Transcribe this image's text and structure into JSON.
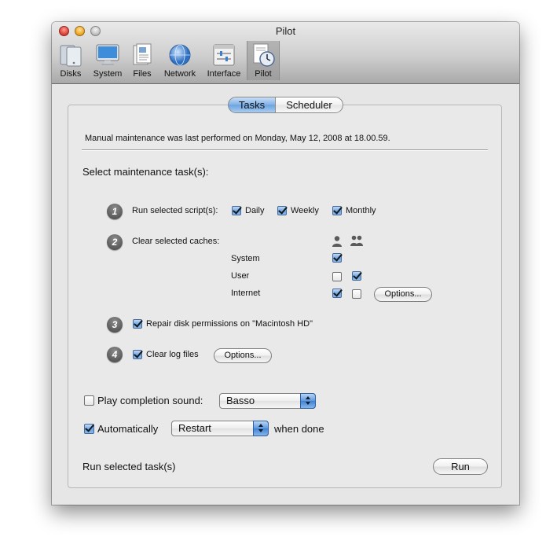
{
  "window": {
    "title": "Pilot"
  },
  "toolbar": {
    "items": [
      {
        "label": "Disks",
        "icon": "disks-icon"
      },
      {
        "label": "System",
        "icon": "monitor-icon"
      },
      {
        "label": "Files",
        "icon": "files-icon"
      },
      {
        "label": "Network",
        "icon": "globe-icon"
      },
      {
        "label": "Interface",
        "icon": "sliders-icon"
      },
      {
        "label": "Pilot",
        "icon": "pilot-clock-icon",
        "selected": true
      }
    ]
  },
  "tabs": {
    "tasks": "Tasks",
    "scheduler": "Scheduler",
    "selected": "Tasks"
  },
  "status": {
    "last_performed": "Manual maintenance was last performed on Monday, May 12, 2008 at 18.00.59."
  },
  "tasks": {
    "heading": "Select maintenance task(s):",
    "step1": {
      "number": "1",
      "label": "Run selected script(s):",
      "daily": {
        "label": "Daily",
        "checked": true
      },
      "weekly": {
        "label": "Weekly",
        "checked": true
      },
      "monthly": {
        "label": "Monthly",
        "checked": true
      }
    },
    "step2": {
      "number": "2",
      "label": "Clear selected caches:",
      "column_icons": [
        "single-user-icon",
        "group-users-icon"
      ],
      "rows": [
        {
          "label": "System",
          "user": true
        },
        {
          "label": "User",
          "user": false,
          "group": true
        },
        {
          "label": "Internet",
          "user": true,
          "group": false
        }
      ],
      "options_label": "Options..."
    },
    "step3": {
      "number": "3",
      "label": "Repair disk permissions on \"Macintosh HD\"",
      "checked": true
    },
    "step4": {
      "number": "4",
      "label": "Clear log files",
      "checked": true,
      "options_label": "Options..."
    }
  },
  "completion": {
    "play_sound_label": "Play completion sound:",
    "play_sound_checked": false,
    "sound_value": "Basso",
    "auto_label": "Automatically",
    "auto_checked": true,
    "auto_value": "Restart",
    "when_done_label": "when done"
  },
  "run": {
    "label": "Run selected task(s)",
    "button": "Run"
  },
  "colors": {
    "accent": "#6aa3e0",
    "window_bg": "#e6e6e6"
  }
}
